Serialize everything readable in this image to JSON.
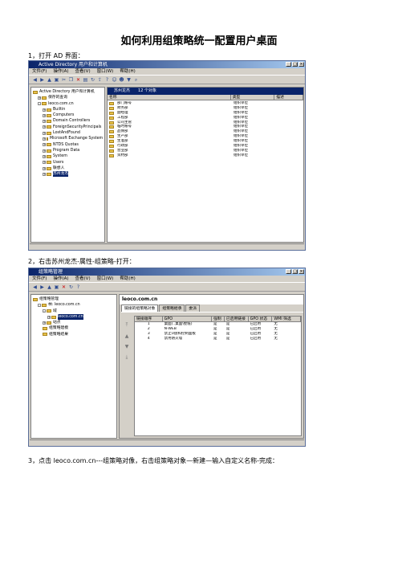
{
  "doc": {
    "title": "如何利用组策略统一配置用户桌面",
    "step1": "1，打开 AD 界面：",
    "step2": "2，右击苏州龙杰-属性-组策略-打开：",
    "step3": "3，点击 leoco.com.cn---组策略对像，右击组策略对象—新建—输入自定义名称-完成："
  },
  "ad": {
    "title": "Active Directory 用户和计算机",
    "menu": [
      "文件(F)",
      "操作(A)",
      "查看(V)",
      "窗口(W)",
      "帮助(H)"
    ],
    "tree": [
      {
        "label": "Active Directory 用户和计算机",
        "lvl": 0,
        "pm": ""
      },
      {
        "label": "保存的查询",
        "lvl": 1,
        "pm": "+"
      },
      {
        "label": "leoco.com.cn",
        "lvl": 1,
        "pm": "-"
      },
      {
        "label": "Builtin",
        "lvl": 2,
        "pm": "+"
      },
      {
        "label": "Computers",
        "lvl": 2,
        "pm": "+"
      },
      {
        "label": "Domain Controllers",
        "lvl": 2,
        "pm": "+"
      },
      {
        "label": "ForeignSecurityPrincipals",
        "lvl": 2,
        "pm": "+"
      },
      {
        "label": "LostAndFound",
        "lvl": 2,
        "pm": "+"
      },
      {
        "label": "Microsoft Exchange System Objects",
        "lvl": 2,
        "pm": "+"
      },
      {
        "label": "NTDS Quotas",
        "lvl": 2,
        "pm": "+"
      },
      {
        "label": "Program Data",
        "lvl": 2,
        "pm": "+"
      },
      {
        "label": "System",
        "lvl": 2,
        "pm": "+"
      },
      {
        "label": "Users",
        "lvl": 2,
        "pm": "+"
      },
      {
        "label": "联想人",
        "lvl": 2,
        "pm": "+"
      },
      {
        "label": "苏州龙杰",
        "lvl": 2,
        "pm": "+",
        "selected": true
      }
    ],
    "tab_name": "苏州龙杰",
    "tab_count": "12 个对象",
    "headers": [
      "名称",
      "类型",
      "描述"
    ],
    "rows": [
      [
        "部门账号",
        "组织单位"
      ],
      [
        "财务部",
        "组织单位"
      ],
      [
        "副经理",
        "组织单位"
      ],
      [
        "工程部",
        "组织单位"
      ],
      [
        "公司主管",
        "组织单位"
      ],
      [
        "临时账号",
        "组织单位"
      ],
      [
        "品保部",
        "组织单位"
      ],
      [
        "生产部",
        "组织单位"
      ],
      [
        "生准部",
        "组织单位"
      ],
      [
        "行政部",
        "组织单位"
      ],
      [
        "营业部",
        "组织单位"
      ],
      [
        "资材部",
        "组织单位"
      ]
    ]
  },
  "gpm": {
    "title": "组策略管理",
    "menu": [
      "文件(F)",
      "操作(A)",
      "查看(V)",
      "窗口(W)",
      "帮助(H)"
    ],
    "tree": [
      {
        "label": "组策略管理",
        "lvl": 0,
        "pm": ""
      },
      {
        "label": "林: leoco.com.cn",
        "lvl": 1,
        "pm": "-"
      },
      {
        "label": "域",
        "lvl": 2,
        "pm": "-"
      },
      {
        "label": "leoco.com.cn",
        "lvl": 3,
        "pm": "+",
        "selected": true
      },
      {
        "label": "站点",
        "lvl": 2,
        "pm": "+"
      },
      {
        "label": "组策略建模",
        "lvl": 2,
        "pm": ""
      },
      {
        "label": "组策略结果",
        "lvl": 2,
        "pm": ""
      }
    ],
    "domain": "leoco.com.cn",
    "tabs": [
      "链接的组策略对象",
      "组策略继承",
      "委派"
    ],
    "headers": [
      "链接顺序",
      "GPO",
      "强制",
      "已启用链接",
      "GPO 状态",
      "WMI 筛选"
    ],
    "rows": [
      [
        "1",
        "桌面(..桌面\\壁纸)",
        "是",
        "是",
        "已启用",
        "无"
      ],
      [
        "2",
        "N-WEB",
        "是",
        "是",
        "已启用",
        "无"
      ],
      [
        "3",
        "禁止U盘和控制面板",
        "是",
        "是",
        "已启用",
        "无"
      ],
      [
        "4",
        "禁用防火墙",
        "是",
        "是",
        "已启用",
        "无"
      ]
    ]
  }
}
